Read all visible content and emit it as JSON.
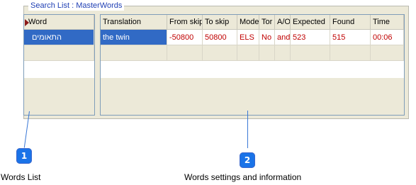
{
  "groupbox": {
    "title": "Search List : MasterWords"
  },
  "words_grid": {
    "header": "Word",
    "rows": [
      {
        "word": "התאומים"
      }
    ]
  },
  "settings_grid": {
    "columns": [
      "Translation",
      "From skip",
      "To skip",
      "Mode",
      "Tor",
      "A/O",
      "Expected",
      "Found",
      "Time"
    ],
    "rows": [
      {
        "translation": "the twin",
        "from_skip": "-50800",
        "to_skip": "50800",
        "mode": "ELS",
        "tor": "No",
        "ao": "and",
        "expected": "523",
        "found": "515",
        "time": "00:06"
      }
    ]
  },
  "callouts": [
    {
      "number": "1",
      "caption": "Words List"
    },
    {
      "number": "2",
      "caption": "Words settings and information"
    }
  ],
  "colors": {
    "selection": "#316ac5",
    "values": "#c00000",
    "callout": "#1a73e8"
  }
}
